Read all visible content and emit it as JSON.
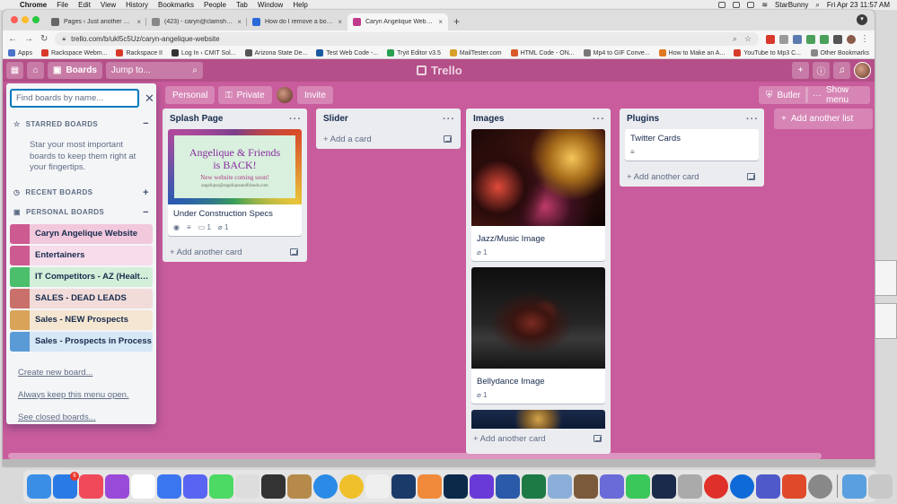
{
  "menubar": {
    "app": "Chrome",
    "items": [
      "File",
      "Edit",
      "View",
      "History",
      "Bookmarks",
      "People",
      "Tab",
      "Window",
      "Help"
    ],
    "user": "StarBunny",
    "datetime": "Fri Apr 23  11:57 AM"
  },
  "browser": {
    "tabs": [
      {
        "title": "Pages ‹ Just another WordPre...",
        "favicon_color": "#666666"
      },
      {
        "title": "(423) - caryn@clamshellcomm...",
        "favicon_color": "#888888"
      },
      {
        "title": "How do I remove a board crea...",
        "favicon_color": "#2a6ad8"
      },
      {
        "title": "Caryn Angelique Website | Trel...",
        "favicon_color": "#c0398a",
        "active": true
      }
    ],
    "new_tab": "+",
    "url": "trello.com/b/ukl5c5Uz/caryn-angelique-website",
    "bookmarks": [
      {
        "label": "Apps",
        "color": "#4a73c9"
      },
      {
        "label": "Rackspace Webm...",
        "color": "#d83a2a"
      },
      {
        "label": "Rackspace II",
        "color": "#d83a2a"
      },
      {
        "label": "Log In ‹ CMIT Sol...",
        "color": "#333333"
      },
      {
        "label": "Arizona State De...",
        "color": "#555555"
      },
      {
        "label": "Test Web Code -...",
        "color": "#1a5aa0"
      },
      {
        "label": "Tryit Editor v3.5",
        "color": "#2aa050"
      },
      {
        "label": "MailTester.com",
        "color": "#d8a02a"
      },
      {
        "label": "HTML Code - ON...",
        "color": "#d85a2a"
      },
      {
        "label": "Mp4 to GIF Conve...",
        "color": "#777777"
      },
      {
        "label": "How to Make an A...",
        "color": "#e07a20"
      },
      {
        "label": "YouTube to Mp3 C...",
        "color": "#d83a2a"
      }
    ],
    "other_bookmarks": "Other Bookmarks"
  },
  "trello": {
    "boards_label": "Boards",
    "jump_placeholder": "Jump to...",
    "logo": "Trello",
    "board_bar": {
      "personal": "Personal",
      "private": "Private",
      "invite": "Invite",
      "butler": "Butler",
      "show_menu": "Show menu"
    },
    "lists": [
      {
        "title": "Splash Page",
        "cards": [
          {
            "title": "Under Construction Specs",
            "cover_text": [
              "Angelique & Friends",
              "is BACK!",
              "New website coming soon!",
              "angelique@angeliqueandfriends.com"
            ],
            "comments": "1",
            "attachments": "1"
          }
        ],
        "add": "Add another card"
      },
      {
        "title": "Slider",
        "cards": [],
        "add": "Add a card"
      },
      {
        "title": "Images",
        "cards": [
          {
            "title": "Jazz/Music Image",
            "attachments": "1"
          },
          {
            "title": "Bellydance Image",
            "attachments": "1"
          }
        ],
        "add": "Add another card"
      },
      {
        "title": "Plugins",
        "cards": [
          {
            "title": "Twitter Cards"
          }
        ],
        "add": "Add another card"
      }
    ],
    "add_list": "Add another list"
  },
  "sidebar": {
    "search_placeholder": "Find boards by name...",
    "starred_heading": "STARRED BOARDS",
    "starred_note": "Star your most important boards to keep them right at your fingertips.",
    "recent_heading": "RECENT BOARDS",
    "personal_heading": "PERSONAL BOARDS",
    "boards": [
      {
        "name": "Caryn Angelique Website",
        "color": "#cd5a91",
        "bg": "#f2c8dc"
      },
      {
        "name": "Entertainers",
        "color": "#cd5a91",
        "bg": "#f7dcea"
      },
      {
        "name": "IT Competitors - AZ (Healthc...",
        "color": "#4bbf6b",
        "bg": "#d3efd9"
      },
      {
        "name": "SALES - DEAD LEADS",
        "color": "#c9706b",
        "bg": "#f2dcda"
      },
      {
        "name": "Sales - NEW Prospects",
        "color": "#d9a45a",
        "bg": "#f5e6d1"
      },
      {
        "name": "Sales - Prospects in Process",
        "color": "#5a9bd5",
        "bg": "#d6e7f5"
      }
    ],
    "links": [
      "Create new board...",
      "Always keep this menu open.",
      "See closed boards..."
    ]
  },
  "dock": {
    "apps": [
      {
        "name": "finder-icon",
        "color": "#3a8ee6"
      },
      {
        "name": "app-store-icon",
        "color": "#2a7ae6",
        "badge": "6"
      },
      {
        "name": "music-icon",
        "color": "#f04a5a"
      },
      {
        "name": "podcasts-icon",
        "color": "#9a4ad8"
      },
      {
        "name": "slack-icon",
        "color": "#ffffff"
      },
      {
        "name": "signal-icon",
        "color": "#3a76f0"
      },
      {
        "name": "discord-icon",
        "color": "#5865f2"
      },
      {
        "name": "messages-icon",
        "color": "#4cd964"
      },
      {
        "name": "bbedit-icon",
        "color": "#dddddd"
      },
      {
        "name": "bartender-icon",
        "color": "#333333"
      },
      {
        "name": "package-icon",
        "color": "#b58a4a"
      },
      {
        "name": "safari-icon",
        "color": "#2a8ae6"
      },
      {
        "name": "chrome-icon",
        "color": "#f0c02a"
      },
      {
        "name": "notes-icon",
        "color": "#efefef"
      },
      {
        "name": "scrivener-icon",
        "color": "#1a3a6a"
      },
      {
        "name": "photos-icon",
        "color": "#f08a3a"
      },
      {
        "name": "photoshop-icon",
        "color": "#0b2a4a"
      },
      {
        "name": "imovie-icon",
        "color": "#6a3ad8"
      },
      {
        "name": "word-icon",
        "color": "#2a5aa8"
      },
      {
        "name": "excel-icon",
        "color": "#1d7a45"
      },
      {
        "name": "preview-icon",
        "color": "#8aaed8"
      },
      {
        "name": "gimp-icon",
        "color": "#7a5a3a"
      },
      {
        "name": "action-icon",
        "color": "#6a6ad8"
      },
      {
        "name": "facetime-icon",
        "color": "#3ac85a"
      },
      {
        "name": "steam-icon",
        "color": "#1a2a4a"
      },
      {
        "name": "quicktime-icon",
        "color": "#aaaaaa"
      },
      {
        "name": "record-icon",
        "color": "#e0302a"
      },
      {
        "name": "teamviewer-icon",
        "color": "#0e6ad8"
      },
      {
        "name": "teams-icon",
        "color": "#5059c9"
      },
      {
        "name": "office-icon",
        "color": "#e04a2a"
      },
      {
        "name": "settings-icon",
        "color": "#888888"
      }
    ],
    "folder_color": "#5aa0e0",
    "trash_color": "#c8c8c8"
  },
  "colors": {
    "board_background": "#c95c9c",
    "header": "#b54f89",
    "list_bg": "#ebecf0"
  }
}
